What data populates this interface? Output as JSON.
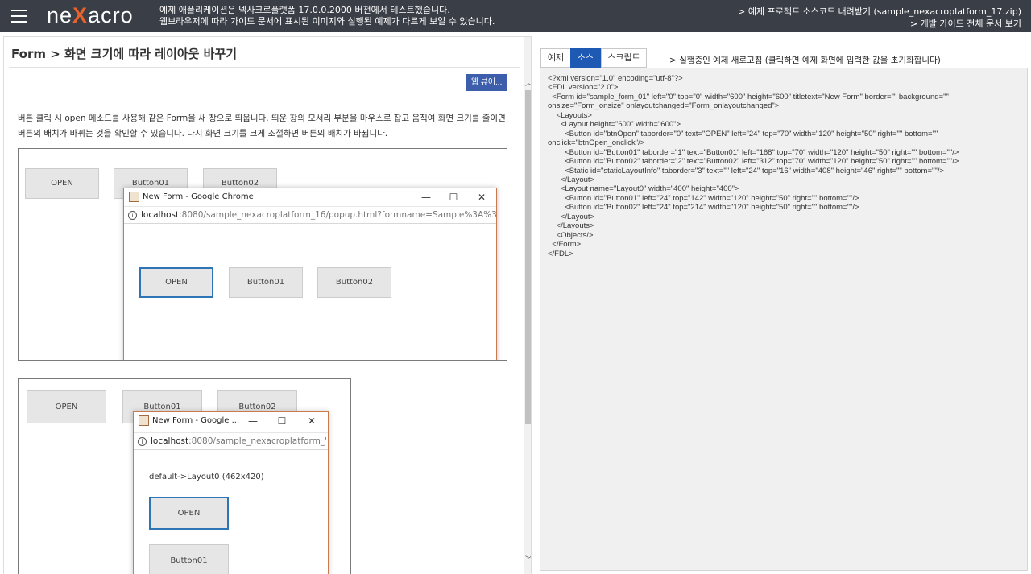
{
  "header": {
    "logo_pre": "ne",
    "logo_x": "X",
    "logo_post": "acro",
    "notice": [
      "예제 애플리케이션은 넥사크로플랫폼 17.0.0.2000 버전에서 테스트했습니다.",
      "웹브라우저에 따라 가이드 문서에 표시된 이미지와 실행된 예제가 다르게 보일 수 있습니다."
    ],
    "links": [
      "> 예제 프로젝트 소스코드 내려받기 (sample_nexacroplatform_17.zip)",
      "> 개발 가이드 전체 문서 보기"
    ]
  },
  "left": {
    "title": "Form > 화면 크기에 따라 레이아웃 바꾸기",
    "webviewer_label": "웹 뷰어...",
    "description": "버튼 클릭 시 open 메소드를 사용해 같은 Form을 새 창으로 띄웁니다. 띄운 창의 모서리 부분을 마우스로 잡고 움직여 화면 크기를 줄이면 버튼의 배치가 바뀌는 것을 확인할 수 있습니다. 다시 화면 크기를 크게 조절하면 버튼의 배치가 바뀝니다.",
    "demo1": {
      "buttons": [
        "OPEN",
        "Button01",
        "Button02"
      ],
      "window": {
        "title": "New Form - Google Chrome",
        "url_host": "localhost",
        "url_rest": ":8080/sample_nexacroplatform_16/popup.html?formname=Sample%3A%3Asamp",
        "buttons": [
          "OPEN",
          "Button01",
          "Button02"
        ]
      }
    },
    "demo2": {
      "buttons": [
        "OPEN",
        "Button01",
        "Button02"
      ],
      "window": {
        "title": "New Form - Google ...",
        "url_host": "localhost",
        "url_rest": ":8080/sample_nexacroplatform_'",
        "static_text": "default->Layout0 (462x420)",
        "buttons": [
          "OPEN",
          "Button01"
        ]
      }
    }
  },
  "window_controls": {
    "minimize": "—",
    "maximize": "☐",
    "close": "✕"
  },
  "right": {
    "tabs": [
      "예제",
      "소스",
      "스크립트"
    ],
    "active_tab": "소스",
    "refresh_text": "> 실행중인 예제 새로고침 (클릭하면 예제 화면에 입력한 값을 초기화합니다)",
    "code": "<?xml version=\"1.0\" encoding=\"utf-8\"?>\n<FDL version=\"2.0\">\n  <Form id=\"sample_form_01\" left=\"0\" top=\"0\" width=\"600\" height=\"600\" titletext=\"New Form\" border=\"\" background=\"\"\nonsize=\"Form_onsize\" onlayoutchanged=\"Form_onlayoutchanged\">\n    <Layouts>\n      <Layout height=\"600\" width=\"600\">\n        <Button id=\"btnOpen\" taborder=\"0\" text=\"OPEN\" left=\"24\" top=\"70\" width=\"120\" height=\"50\" right=\"\" bottom=\"\"\nonclick=\"btnOpen_onclick\"/>\n        <Button id=\"Button01\" taborder=\"1\" text=\"Button01\" left=\"168\" top=\"70\" width=\"120\" height=\"50\" right=\"\" bottom=\"\"/>\n        <Button id=\"Button02\" taborder=\"2\" text=\"Button02\" left=\"312\" top=\"70\" width=\"120\" height=\"50\" right=\"\" bottom=\"\"/>\n        <Static id=\"staticLayoutInfo\" taborder=\"3\" text=\"\" left=\"24\" top=\"16\" width=\"408\" height=\"46\" right=\"\" bottom=\"\"/>\n      </Layout>\n      <Layout name=\"Layout0\" width=\"400\" height=\"400\">\n        <Button id=\"Button01\" left=\"24\" top=\"142\" width=\"120\" height=\"50\" right=\"\" bottom=\"\"/>\n        <Button id=\"Button02\" left=\"24\" top=\"214\" width=\"120\" height=\"50\" right=\"\" bottom=\"\"/>\n      </Layout>\n    </Layouts>\n    <Objects/>\n  </Form>\n</FDL>"
  },
  "colors": {
    "header_bg": "#3a3f47",
    "accent_orange": "#e8622c",
    "tab_active": "#1e5ab3",
    "webviewer_btn": "#3d5fab",
    "code_bg": "#f0f0f0"
  }
}
